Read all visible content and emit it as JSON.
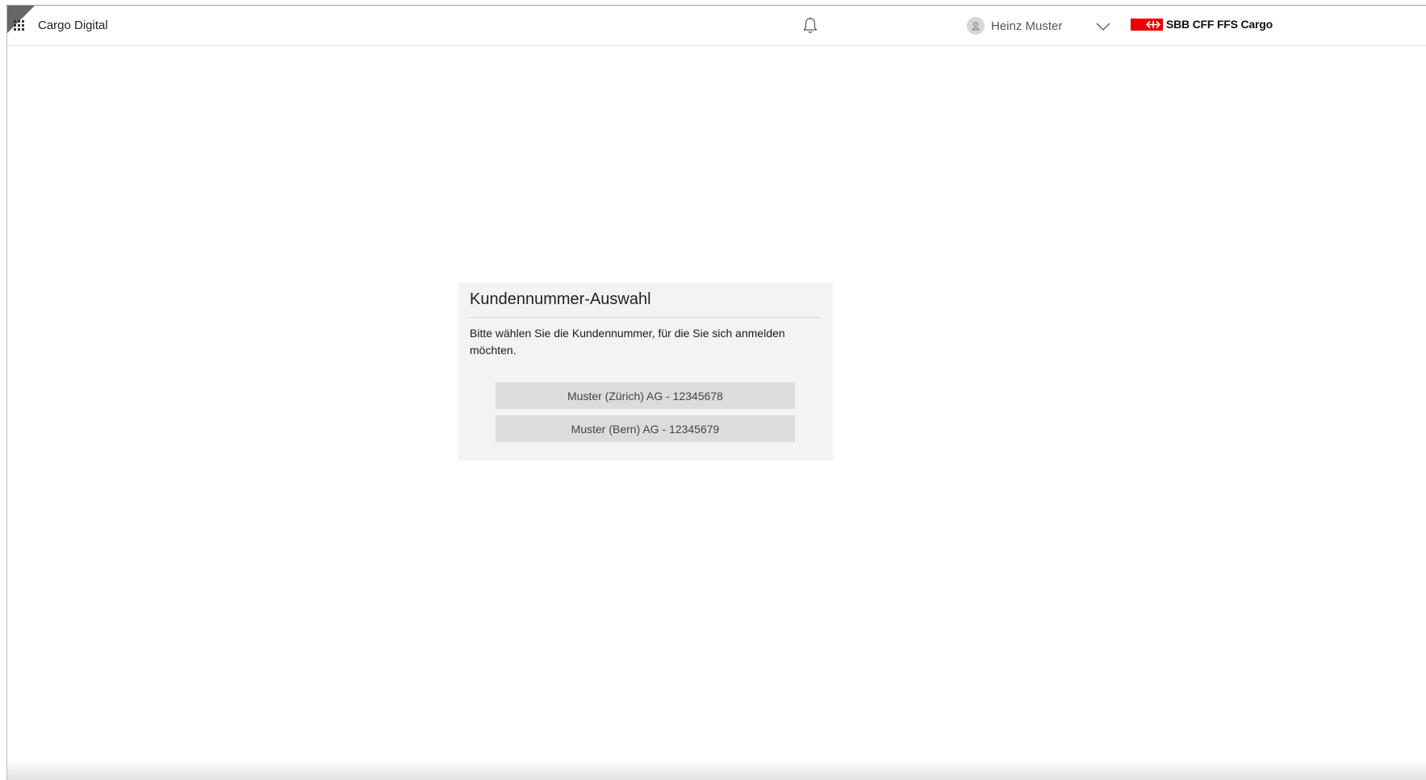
{
  "header": {
    "app_title": "Cargo Digital",
    "user": {
      "name": "Heinz Muster"
    },
    "brand": {
      "text": "SBB CFF FFS Cargo",
      "flag_color": "#eb0000"
    },
    "icons": [
      "grid-icon",
      "bell-icon",
      "avatar-icon",
      "chevron-down-icon",
      "sbb-logo-icon"
    ]
  },
  "dialog": {
    "title": "Kundennummer-Auswahl",
    "description": "Bitte wählen Sie die Kundennummer, für die Sie sich anmelden möchten.",
    "options": [
      {
        "label": "Muster (Zürich) AG - 12345678"
      },
      {
        "label": "Muster (Bern) AG - 12345679"
      }
    ]
  },
  "colors": {
    "card_background": "#f3f3f3",
    "button_background": "#dcdcdc",
    "brand_red": "#eb0000"
  }
}
